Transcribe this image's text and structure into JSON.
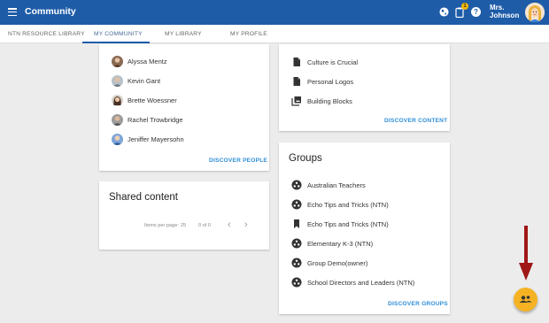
{
  "topbar": {
    "title": "Community",
    "notification_count": "1",
    "help_glyph": "?",
    "user_line1": "Mrs.",
    "user_line2": "Johnson"
  },
  "tabs": [
    {
      "label": "NTN RESOURCE LIBRARY"
    },
    {
      "label": "MY COMMUNITY"
    },
    {
      "label": "MY LIBRARY"
    },
    {
      "label": "MY PROFILE"
    }
  ],
  "people": {
    "items": [
      {
        "name": "Alyssa Mentz"
      },
      {
        "name": "Kevin Gant"
      },
      {
        "name": "Brette Woessner"
      },
      {
        "name": "Rachel Trowbridge"
      },
      {
        "name": "Jeniffer Mayersohn"
      }
    ],
    "action": "DISCOVER PEOPLE"
  },
  "content": {
    "items": [
      {
        "name": "Culture is Crucial",
        "icon": "document-icon"
      },
      {
        "name": "Personal Logos",
        "icon": "document-icon"
      },
      {
        "name": "Building Blocks",
        "icon": "collection-icon"
      }
    ],
    "action": "DISCOVER CONTENT"
  },
  "shared": {
    "title": "Shared content",
    "items_per_page_label": "Items per page:",
    "items_per_page_value": "25",
    "range": "0 of 0",
    "prev_glyph": "‹",
    "next_glyph": "›"
  },
  "groups": {
    "title": "Groups",
    "items": [
      {
        "name": "Australian Teachers",
        "icon": "group-icon"
      },
      {
        "name": "Echo Tips and Tricks (NTN)",
        "icon": "group-icon"
      },
      {
        "name": "Echo Tips and Tricks (NTN)",
        "icon": "bookmark-icon"
      },
      {
        "name": "Elementary K-3 (NTN)",
        "icon": "group-icon"
      },
      {
        "name": "Group Demo(owner)",
        "icon": "group-icon"
      },
      {
        "name": "School Directors and Leaders (NTN)",
        "icon": "group-icon"
      }
    ],
    "action": "DISCOVER GROUPS"
  },
  "colors": {
    "brand": "#1e5ca8",
    "link": "#2f8fd8",
    "fab": "#f5b324",
    "annotation_arrow": "#a01717"
  }
}
